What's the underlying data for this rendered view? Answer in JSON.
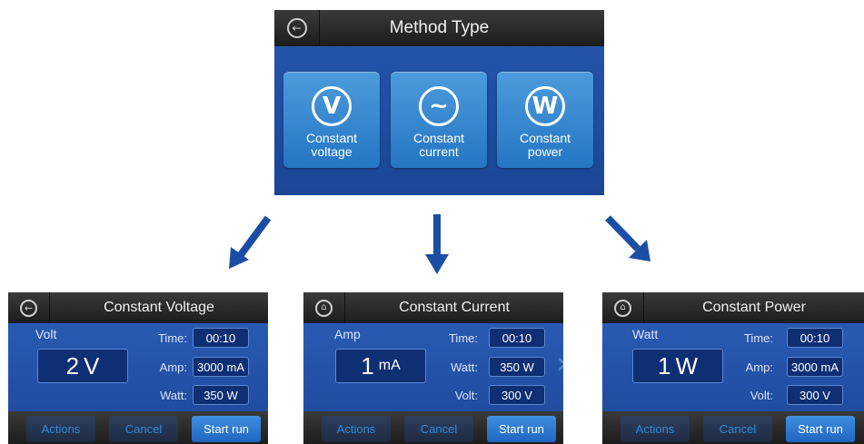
{
  "main": {
    "title": "Method Type",
    "back_icon": "back-arrow-icon",
    "methods": [
      {
        "symbol": "V",
        "label": "Constant voltage",
        "icon": "voltage-icon"
      },
      {
        "symbol": "~",
        "label": "Constant current",
        "icon": "current-icon"
      },
      {
        "symbol": "W",
        "label": "Constant power",
        "icon": "power-icon"
      }
    ]
  },
  "screens": [
    {
      "title": "Constant Voltage",
      "nav_icon": "back-arrow-icon",
      "unit_label": "Volt",
      "main_value": "2",
      "main_unit": "V",
      "params": [
        {
          "label": "Time:",
          "value": "00:10"
        },
        {
          "label": "Amp:",
          "value": "3000 mA"
        },
        {
          "label": "Watt:",
          "value": "350 W"
        }
      ],
      "actions": "Actions",
      "cancel": "Cancel",
      "start": "Start run"
    },
    {
      "title": "Constant Current",
      "nav_icon": "home-icon",
      "unit_label": "Amp",
      "main_value": "1",
      "main_unit": "mA",
      "params": [
        {
          "label": "Time:",
          "value": "00:10"
        },
        {
          "label": "Watt:",
          "value": "350 W"
        },
        {
          "label": "Volt:",
          "value": "300 V"
        }
      ],
      "actions": "Actions",
      "cancel": "Cancel",
      "start": "Start run"
    },
    {
      "title": "Constant Power",
      "nav_icon": "home-icon",
      "unit_label": "Watt",
      "main_value": "1",
      "main_unit": "W",
      "params": [
        {
          "label": "Time:",
          "value": "00:10"
        },
        {
          "label": "Amp:",
          "value": "3000 mA"
        },
        {
          "label": "Volt:",
          "value": "300 V"
        }
      ],
      "actions": "Actions",
      "cancel": "Cancel",
      "start": "Start run"
    }
  ],
  "colors": {
    "screen_blue": "#1f4fa3",
    "button_blue": "#2f86d0",
    "arrow_blue": "#1a4ea5"
  }
}
